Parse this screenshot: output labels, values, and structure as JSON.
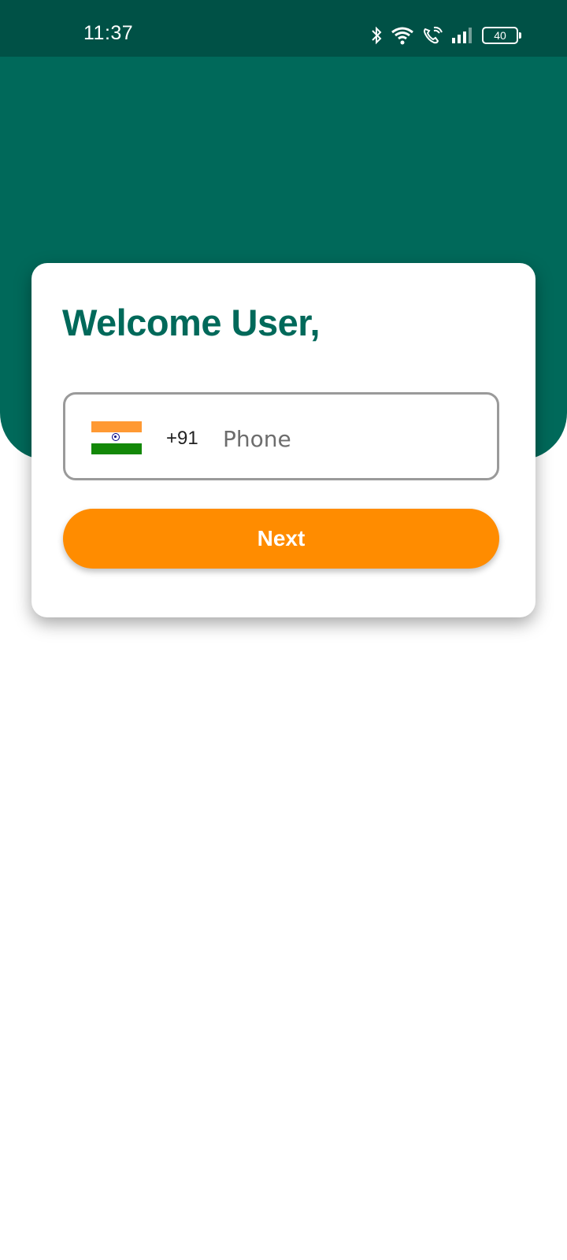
{
  "status_bar": {
    "time": "11:37",
    "battery_level": "40",
    "icons": [
      "bluetooth-icon",
      "wifi-icon",
      "wifi-calling-icon",
      "signal-icon",
      "battery-icon"
    ]
  },
  "login": {
    "welcome_title": "Welcome User,",
    "country_flag": "india-flag-icon",
    "dial_code": "+91",
    "phone_placeholder": "Phone",
    "phone_value": "",
    "next_label": "Next"
  },
  "colors": {
    "status_bar": "#005146",
    "header": "#00695a",
    "title": "#00695a",
    "button": "#ff8c00"
  }
}
